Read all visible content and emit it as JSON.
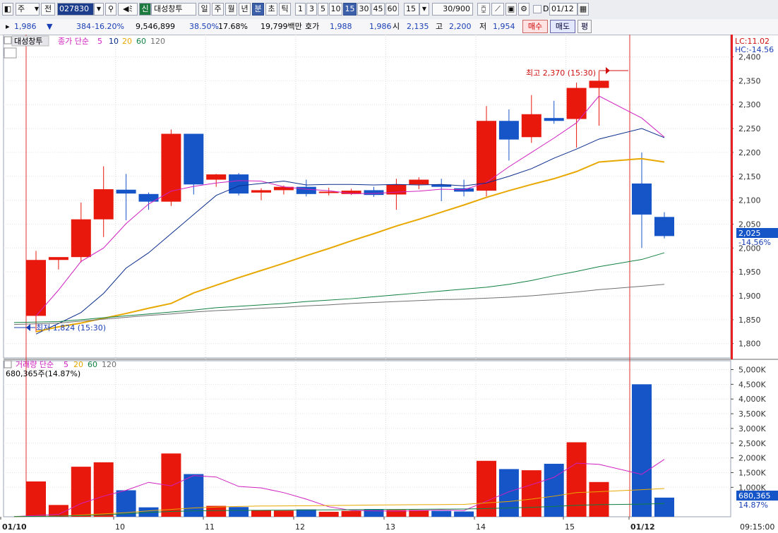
{
  "toolbar": {
    "period_left": "주",
    "prev": "전",
    "code": "027830",
    "badge": "신",
    "stock_name": "대성창투",
    "periods": [
      "일",
      "주",
      "월",
      "년",
      "분",
      "초",
      "틱"
    ],
    "intervals": [
      "1",
      "3",
      "5",
      "10",
      "15",
      "30",
      "45",
      "60"
    ],
    "interval_selected": "15",
    "interval_value": "15",
    "count": "30/900",
    "check_label": "D",
    "date": "01/12"
  },
  "quote": {
    "price": "1,986",
    "arrow": "▼",
    "change": "384",
    "change_pct": "-16.20%",
    "volume": "9,546,899",
    "pct2": "38.50%",
    "pct3": "17.68%",
    "amount": "19,799백만",
    "bid_label": "호가",
    "bid1": "1,988",
    "bid2": "1,986",
    "open_label": "시",
    "open": "2,135",
    "high_label": "고",
    "high": "2,200",
    "low_label": "저",
    "low": "1,954",
    "buy_button": "매수",
    "sell_button": "매도",
    "eval_button": "평"
  },
  "price_legend": {
    "name": "대성창투",
    "ma_title": "종가 단순",
    "ma": [
      "5",
      "10",
      "20",
      "60",
      "120"
    ]
  },
  "right_labels": {
    "lc": "LC:11.02",
    "hc": "HC:-14.56",
    "price_tag": "2,025",
    "price_pct": "-14.56%",
    "vol_tag": "680,365",
    "vol_pct": "14.87%"
  },
  "annotations": {
    "high": "최고 2,370 (15:30)",
    "low": "최저 1,824 (15:30)"
  },
  "volume_legend": {
    "title": "거래량 단순",
    "ma": [
      "5",
      "20",
      "60",
      "120"
    ],
    "value": "680,365주(14.87%)"
  },
  "x_axis": {
    "labels": [
      "01/10",
      "10",
      "11",
      "12",
      "13",
      "14",
      "15",
      "01/12"
    ],
    "time": "09:15:00"
  },
  "colors": {
    "up": "#e8180c",
    "down": "#1655c8",
    "ma5": "#d020c0",
    "ma10": "#0a2c8c",
    "ma20": "#e8a800",
    "ma60": "#108040",
    "ma120": "#707070"
  },
  "chart_data": [
    {
      "type": "candlestick",
      "title": "",
      "ylabel": "",
      "ylim": [
        1770,
        2420
      ],
      "yticks": [
        1800,
        1850,
        1900,
        1950,
        2000,
        2050,
        2100,
        2150,
        2200,
        2250,
        2300,
        2350,
        2400
      ],
      "candles": [
        {
          "o": 1858,
          "h": 1994,
          "l": 1824,
          "c": 1975
        },
        {
          "o": 1975,
          "h": 1978,
          "l": 1955,
          "c": 1981
        },
        {
          "o": 1981,
          "h": 2095,
          "l": 1970,
          "c": 2060
        },
        {
          "o": 2060,
          "h": 2171,
          "l": 2023,
          "c": 2123
        },
        {
          "o": 2122,
          "h": 2155,
          "l": 2058,
          "c": 2114
        },
        {
          "o": 2113,
          "h": 2116,
          "l": 2080,
          "c": 2097
        },
        {
          "o": 2097,
          "h": 2248,
          "l": 2088,
          "c": 2239
        },
        {
          "o": 2239,
          "h": 2239,
          "l": 2112,
          "c": 2133
        },
        {
          "o": 2143,
          "h": 2155,
          "l": 2128,
          "c": 2154
        },
        {
          "o": 2154,
          "h": 2157,
          "l": 2110,
          "c": 2114
        },
        {
          "o": 2116,
          "h": 2125,
          "l": 2100,
          "c": 2121
        },
        {
          "o": 2121,
          "h": 2131,
          "l": 2112,
          "c": 2128
        },
        {
          "o": 2128,
          "h": 2143,
          "l": 2108,
          "c": 2113
        },
        {
          "o": 2117,
          "h": 2126,
          "l": 2110,
          "c": 2118
        },
        {
          "o": 2113,
          "h": 2124,
          "l": 2111,
          "c": 2120
        },
        {
          "o": 2121,
          "h": 2128,
          "l": 2107,
          "c": 2111
        },
        {
          "o": 2112,
          "h": 2145,
          "l": 2080,
          "c": 2133
        },
        {
          "o": 2133,
          "h": 2148,
          "l": 2123,
          "c": 2143
        },
        {
          "o": 2133,
          "h": 2145,
          "l": 2098,
          "c": 2128
        },
        {
          "o": 2125,
          "h": 2143,
          "l": 2108,
          "c": 2118
        },
        {
          "o": 2120,
          "h": 2297,
          "l": 2108,
          "c": 2266
        },
        {
          "o": 2266,
          "h": 2290,
          "l": 2183,
          "c": 2227
        },
        {
          "o": 2232,
          "h": 2320,
          "l": 2220,
          "c": 2280
        },
        {
          "o": 2272,
          "h": 2308,
          "l": 2260,
          "c": 2266
        },
        {
          "o": 2270,
          "h": 2346,
          "l": 2210,
          "c": 2335
        },
        {
          "o": 2335,
          "h": 2370,
          "l": 2256,
          "c": 2350
        },
        {
          "o": 2135,
          "h": 2200,
          "l": 2000,
          "c": 2070
        },
        {
          "o": 2065,
          "h": 2075,
          "l": 2020,
          "c": 2025
        }
      ],
      "series": [
        {
          "name": "5",
          "values": [
            1858,
            1912,
            1972,
            2000,
            2051,
            2092,
            2119,
            2129,
            2136,
            2141,
            2140,
            2128,
            2123,
            2120,
            2114,
            2114,
            2117,
            2119,
            2123,
            2122,
            2137,
            2170,
            2200,
            2230,
            2262,
            2318,
            2272,
            2232
          ]
        },
        {
          "name": "10",
          "values": [
            1820,
            1842,
            1865,
            1905,
            1958,
            1990,
            2030,
            2070,
            2110,
            2130,
            2135,
            2140,
            2132,
            2133,
            2133,
            2132,
            2133,
            2132,
            2133,
            2130,
            2136,
            2150,
            2166,
            2188,
            2207,
            2228,
            2250,
            2231
          ]
        },
        {
          "name": "20",
          "values": [
            1825,
            1835,
            1843,
            1853,
            1863,
            1874,
            1884,
            1906,
            1922,
            1938,
            1953,
            1968,
            1984,
            1999,
            2015,
            2030,
            2046,
            2060,
            2075,
            2090,
            2106,
            2120,
            2133,
            2145,
            2160,
            2180,
            2187,
            2180
          ]
        },
        {
          "name": "60",
          "values": [
            1844,
            1846,
            1850,
            1854,
            1858,
            1862,
            1866,
            1870,
            1875,
            1878,
            1881,
            1884,
            1888,
            1891,
            1894,
            1898,
            1902,
            1906,
            1910,
            1914,
            1918,
            1924,
            1932,
            1942,
            1951,
            1961,
            1976,
            1990
          ]
        },
        {
          "name": "120",
          "values": [
            1840,
            1843,
            1847,
            1851,
            1855,
            1859,
            1862,
            1866,
            1869,
            1871,
            1874,
            1876,
            1879,
            1881,
            1884,
            1886,
            1888,
            1890,
            1892,
            1893,
            1895,
            1897,
            1900,
            1904,
            1908,
            1913,
            1920,
            1924
          ]
        }
      ]
    },
    {
      "type": "bar",
      "title": "",
      "ylabel": "",
      "ylim": [
        0,
        5300000
      ],
      "yticks": [
        1000000,
        1500000,
        2000000,
        2500000,
        3000000,
        3500000,
        4000000,
        4500000,
        5000000
      ],
      "ytick_labels": [
        "1,000K",
        "1,500K",
        "2,000K",
        "2,500K",
        "3,000K",
        "3,500K",
        "4,000K",
        "4,500K",
        "5,000K"
      ],
      "values": [
        1200000,
        400000,
        1700000,
        1850000,
        900000,
        320000,
        2150000,
        1450000,
        370000,
        330000,
        230000,
        210000,
        250000,
        170000,
        200000,
        260000,
        230000,
        230000,
        200000,
        180000,
        1900000,
        1620000,
        1580000,
        1800000,
        2530000,
        1180000,
        4500000,
        650000
      ],
      "series": [
        {
          "name": "5",
          "values": [
            5000,
            80000,
            450000,
            700000,
            900000,
            1170000,
            1050000,
            1400000,
            1350000,
            1030000,
            980000,
            820000,
            600000,
            340000,
            220000,
            200000,
            190000,
            210000,
            230000,
            210000,
            530000,
            850000,
            1090000,
            1340000,
            1820000,
            1780000,
            1440000,
            1950000
          ]
        },
        {
          "name": "20",
          "values": [
            5000,
            20000,
            60000,
            100000,
            140000,
            200000,
            250000,
            300000,
            330000,
            350000,
            365000,
            370000,
            375000,
            380000,
            390000,
            400000,
            405000,
            410000,
            415000,
            420000,
            470000,
            520000,
            600000,
            700000,
            820000,
            850000,
            920000,
            960000
          ]
        },
        {
          "name": "60",
          "values": [
            5000,
            20000,
            40000,
            60000,
            100000,
            150000,
            180000,
            200000,
            210000,
            215000,
            220000,
            225000,
            230000,
            235000,
            240000,
            245000,
            250000,
            255000,
            260000,
            265000,
            280000,
            300000,
            320000,
            350000,
            390000,
            410000,
            430000,
            450000
          ]
        }
      ]
    }
  ]
}
